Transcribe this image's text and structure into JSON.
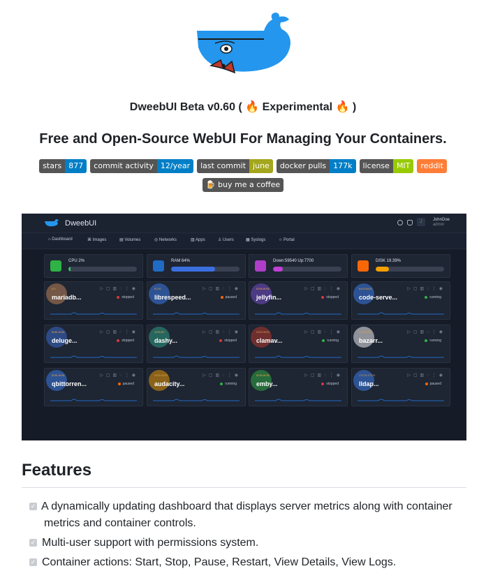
{
  "title": "DweebUI Beta v0.60 ( 🔥 Experimental 🔥 )",
  "subtitle": "Free and Open-Source WebUI For Managing Your Containers.",
  "badges": [
    {
      "label": "stars",
      "value": "877",
      "color": "#007ec6"
    },
    {
      "label": "commit activity",
      "value": "12/year",
      "color": "#007ec6"
    },
    {
      "label": "last commit",
      "value": "june",
      "color": "#a4a61d"
    },
    {
      "label": "docker pulls",
      "value": "177k",
      "color": "#007ec6"
    },
    {
      "label": "license",
      "value": "MIT",
      "color": "#97ca00"
    }
  ],
  "reddit_badge": {
    "value": "reddit",
    "color": "#fe7d37"
  },
  "coffee_badge": {
    "value": "🍺 buy me a coffee"
  },
  "screenshot": {
    "brand": "DweebUI",
    "user_name": "JohnDoe",
    "user_role": "admin",
    "nav": [
      "Dashboard",
      "Images",
      "Volumes",
      "Networks",
      "Apps",
      "Users",
      "Syslogs",
      "Portal"
    ],
    "metrics": [
      {
        "label": "CPU 2%",
        "value": 2,
        "color": "#2fb344",
        "fill": "#3dc061"
      },
      {
        "label": "RAM 64%",
        "value": 64,
        "color": "#206bc4",
        "fill": "#3b6fe0"
      },
      {
        "label": "Down:59540 Up:7700",
        "value": 14,
        "color": "#ae3ec9",
        "fill": "#c13fd6"
      },
      {
        "label": "DISK 19.39%",
        "value": 19,
        "color": "#f76707",
        "fill": "#f59f00"
      }
    ],
    "containers": [
      {
        "name": "mariadb...",
        "port": "0:0",
        "status": "stopped",
        "status_color": "#d63939",
        "icon_color": "#c98a5a"
      },
      {
        "name": "librespeed...",
        "port": "81:81",
        "status": "paused",
        "status_color": "#f76707",
        "icon_color": "#3b82f6"
      },
      {
        "name": "jellyfin...",
        "port": "8096:8096",
        "status": "stopped",
        "status_color": "#d63939",
        "icon_color": "#7a4fd6"
      },
      {
        "name": "code-serve...",
        "port": "8443:8443",
        "status": "running",
        "status_color": "#2fb344",
        "icon_color": "#3b82f6"
      },
      {
        "name": "deluge...",
        "port": "8081:8081",
        "status": "stopped",
        "status_color": "#d63939",
        "icon_color": "#3b6fd6"
      },
      {
        "name": "dashy...",
        "port": "4000:80",
        "status": "stopped",
        "status_color": "#d63939",
        "icon_color": "#2fa88a"
      },
      {
        "name": "clamav...",
        "port": "3310:3310",
        "status": "running",
        "status_color": "#2fb344",
        "icon_color": "#c0392b"
      },
      {
        "name": "bazarr...",
        "port": "6767:6767",
        "status": "running",
        "status_color": "#2fb344",
        "icon_color": "#ffffff"
      },
      {
        "name": "qbittorren...",
        "port": "8081:8081",
        "status": "paused",
        "status_color": "#f76707",
        "icon_color": "#3b82f6"
      },
      {
        "name": "audacity...",
        "port": "3000:3000",
        "status": "running",
        "status_color": "#2fb344",
        "icon_color": "#f59f00"
      },
      {
        "name": "emby...",
        "port": "8096:8096",
        "status": "stopped",
        "status_color": "#d63939",
        "icon_color": "#2fb344"
      },
      {
        "name": "lldap...",
        "port": "17170:17170",
        "status": "paused",
        "status_color": "#f76707",
        "icon_color": "#3b82f6"
      }
    ]
  },
  "features_heading": "Features",
  "features": [
    "A dynamically updating dashboard that displays server metrics along with container",
    "metrics and container controls.",
    "Multi-user support with permissions system.",
    "Container actions: Start, Stop, Pause, Restart, View Details, View Logs."
  ]
}
